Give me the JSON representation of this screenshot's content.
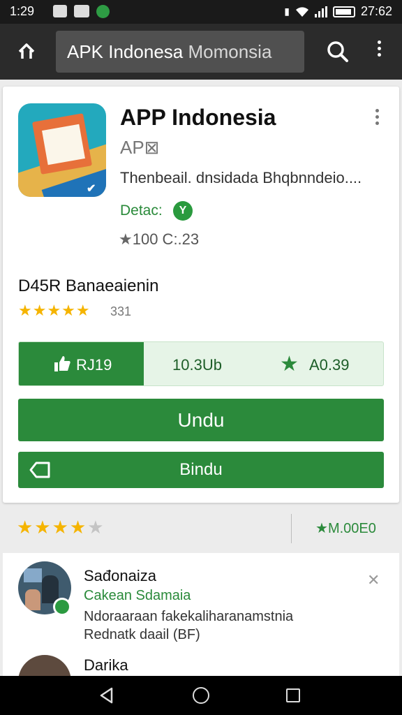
{
  "status_bar": {
    "time_left": "1:29",
    "time_right": "27:62"
  },
  "toolbar": {
    "search_value_main": "APK Indonesa",
    "search_value_rest": "Momonsia"
  },
  "app": {
    "title": "APP Indonesia",
    "developer": "AP⊠",
    "description": "Thenbeail. dnsidada Bhqbnndeio....",
    "detail_label": "Detac:",
    "detail_badge": "Y",
    "stat": "100 C:.23"
  },
  "rating": {
    "title": "D45R Banaeaienin",
    "stars": "★★★★★",
    "count": "331"
  },
  "stats": {
    "likes": "RJ19",
    "downloads": "10.3Ub",
    "score": "A0.39"
  },
  "buttons": {
    "install": "Undu",
    "share": "Bindu"
  },
  "summary": {
    "stars_on": "★★★★",
    "stars_off": "★",
    "score": "M.00E0",
    "score_star": "★"
  },
  "reviews": [
    {
      "name": "Sađonaiza",
      "subtitle": "Cakean Sdamaia",
      "text": "Ndoraaraan fakekaliharanamstnia",
      "text2": "Rednatk daail (BF)"
    },
    {
      "name": "Darika"
    }
  ],
  "icons": {
    "close": "✕",
    "app_check": "✔"
  },
  "colors": {
    "accent": "#2b8a3b",
    "star": "#f5b400",
    "toolbar": "#2b2b2b"
  }
}
